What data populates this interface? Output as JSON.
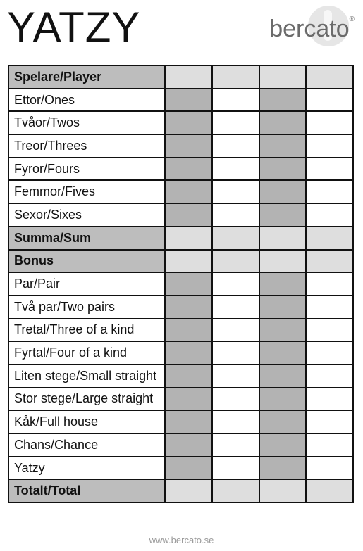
{
  "title": "YATZY",
  "brand": {
    "name": "bercato",
    "mark": "®"
  },
  "rows": [
    {
      "label": "Spelare/Player",
      "type": "head"
    },
    {
      "label": "Ettor/Ones",
      "type": "body"
    },
    {
      "label": "Tvåor/Twos",
      "type": "body"
    },
    {
      "label": "Treor/Threes",
      "type": "body"
    },
    {
      "label": "Fyror/Fours",
      "type": "body"
    },
    {
      "label": "Femmor/Fives",
      "type": "body"
    },
    {
      "label": "Sexor/Sixes",
      "type": "body"
    },
    {
      "label": "Summa/Sum",
      "type": "head"
    },
    {
      "label": "Bonus",
      "type": "head"
    },
    {
      "label": "Par/Pair",
      "type": "body"
    },
    {
      "label": "Två par/Two pairs",
      "type": "body"
    },
    {
      "label": "Tretal/Three of a kind",
      "type": "body"
    },
    {
      "label": "Fyrtal/Four of a kind",
      "type": "body"
    },
    {
      "label": "Liten stege/Small straight",
      "type": "body"
    },
    {
      "label": "Stor stege/Large straight",
      "type": "body"
    },
    {
      "label": "Kåk/Full house",
      "type": "body"
    },
    {
      "label": "Chans/Chance",
      "type": "body"
    },
    {
      "label": "Yatzy",
      "type": "body"
    },
    {
      "label": "Totalt/Total",
      "type": "head"
    }
  ],
  "footer": "www.bercato.se"
}
